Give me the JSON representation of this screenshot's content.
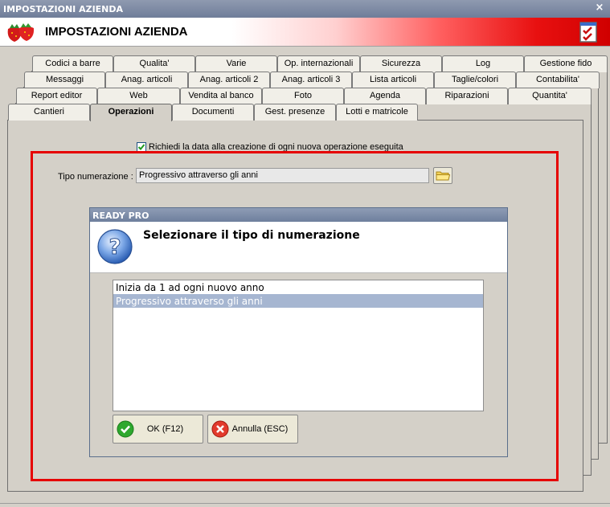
{
  "window": {
    "title": "IMPOSTAZIONI AZIENDA",
    "close": "×"
  },
  "header": {
    "title": "IMPOSTAZIONI AZIENDA"
  },
  "tabs": {
    "row1": [
      "Codici a barre",
      "Qualita'",
      "Varie",
      "Op. internazionali",
      "Sicurezza",
      "Log",
      "Gestione fido"
    ],
    "row2": [
      "Messaggi",
      "Anag. articoli",
      "Anag. articoli 2",
      "Anag. articoli 3",
      "Lista articoli",
      "Taglie/colori",
      "Contabilita'"
    ],
    "row3": [
      "Report editor",
      "Web",
      "Vendita al banco",
      "Foto",
      "Agenda",
      "Riparazioni",
      "Quantita'"
    ],
    "row4": [
      "Cantieri",
      "Operazioni",
      "Documenti",
      "Gest. presenze",
      "Lotti e matricole"
    ],
    "active": "Operazioni"
  },
  "option": {
    "checkbox_label": "Richiedi la data alla creazione di ogni nuova operazione eseguita",
    "checked": true
  },
  "field": {
    "label": "Tipo numerazione :",
    "value": "Progressivo attraverso gli anni"
  },
  "dialog": {
    "title": "READY PRO",
    "message": "Selezionare il tipo di numerazione",
    "choices": [
      "Inizia da 1 ad ogni nuovo anno",
      "Progressivo attraverso gli anni"
    ],
    "selected_index": 1,
    "ok_label": "OK (F12)",
    "cancel_label": "Annulla (ESC)"
  },
  "colors": {
    "highlight": "#e60000",
    "selection": "#a6b6d1",
    "titlebar": "#7a87a2"
  }
}
